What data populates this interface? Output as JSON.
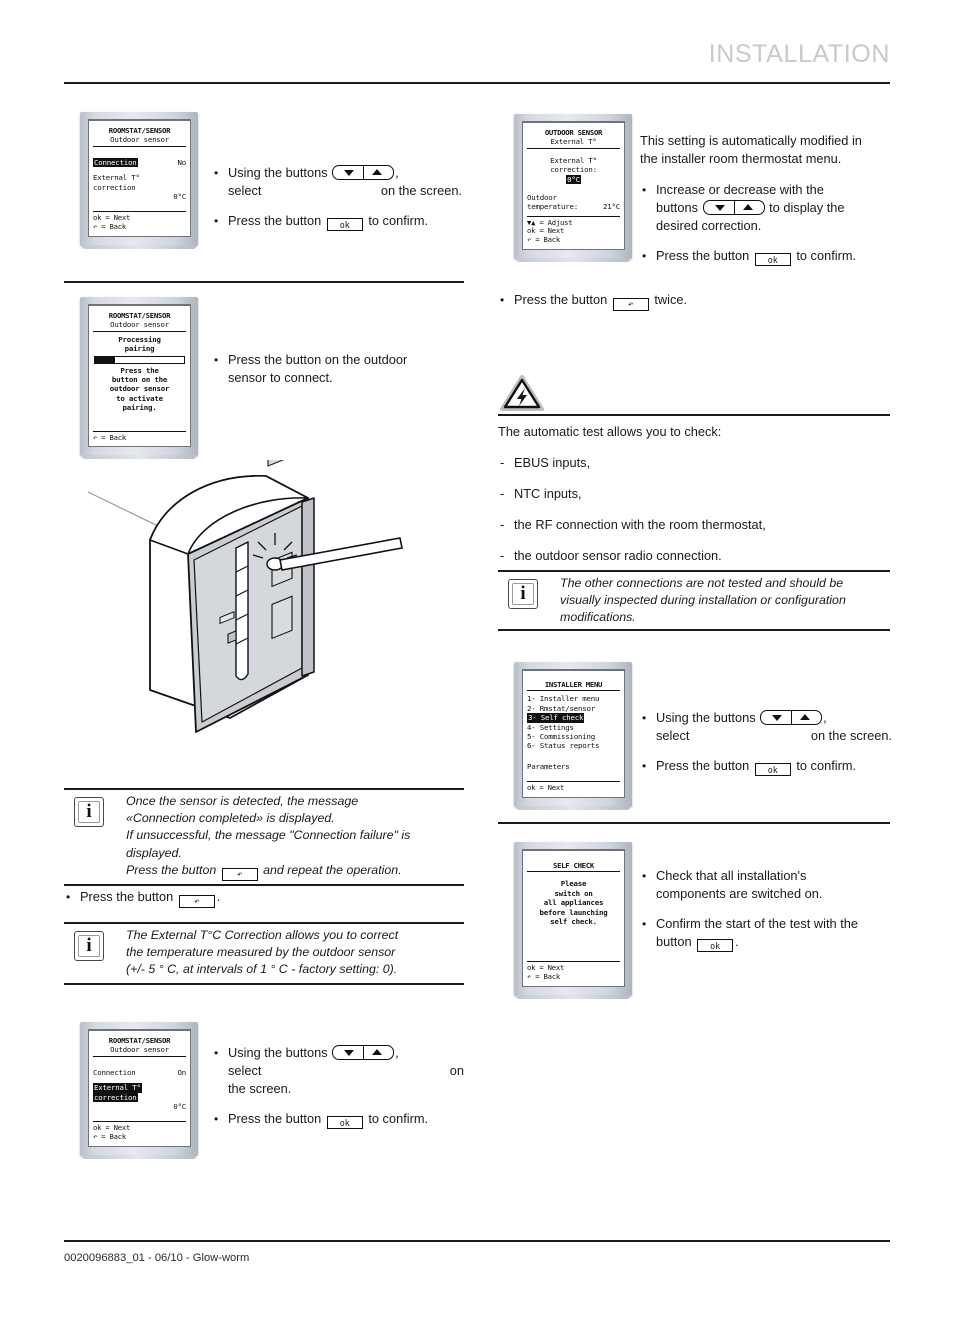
{
  "header": {
    "title": "INSTALLATION"
  },
  "footer": {
    "text": "0020096883_01 - 06/10 - Glow-worm"
  },
  "keys": {
    "ok": "ok",
    "back": "↶",
    "arrows_label": "down-up-arrows"
  },
  "left_column": {
    "step1": {
      "screen": {
        "title": "ROOMSTAT/SENSOR",
        "subtitle": "Outdoor sensor",
        "row1_label": "Connection",
        "row1_value": "No",
        "row2_label_line1": "External T°",
        "row2_label_line2": "correction",
        "row2_value": "0°C",
        "foot_line1": "ok  = Next",
        "foot_line2": "↶   = Back"
      },
      "bullet1_pre": "Using the buttons",
      "bullet1_post": ",",
      "bullet1_line2_pre": "select",
      "bullet1_line2_post": "on the screen.",
      "bullet2_pre": "Press the button",
      "bullet2_post": "to confirm."
    },
    "step2": {
      "screen": {
        "title": "ROOMSTAT/SENSOR",
        "subtitle": "Outdoor sensor",
        "msg_line1": "Processing",
        "msg_line2": "pairing",
        "body_line1": "Press the",
        "body_line2": "button on the",
        "body_line3": "outdoor sensor",
        "body_line4": "to activate",
        "body_line5": "pairing.",
        "foot_line1": "↶   = Back"
      },
      "bullet1_line1": "Press the button on the outdoor",
      "bullet1_line2": "sensor to connect."
    },
    "note1": {
      "line1": "Once the sensor is detected, the message",
      "line2": "«Connection completed» is displayed.",
      "line3": "If unsuccessful, the message \"Connection failure\" is",
      "line4": "displayed.",
      "line5_pre": "Press the button",
      "line5_post": "and repeat the operation."
    },
    "press_back_bullet": {
      "pre": "Press the button",
      "post": "."
    },
    "note2": {
      "line1": "The External T°C Correction allows you to correct",
      "line2": "the temperature measured by the outdoor sensor",
      "line3": "(+/- 5 ° C, at intervals of  1 ° C - factory setting: 0)."
    },
    "step3": {
      "screen": {
        "title": "ROOMSTAT/SENSOR",
        "subtitle": "Outdoor sensor",
        "row1_label": "Connection",
        "row1_value": "On",
        "row2_label_line1": "External T°",
        "row2_label_line2": "correction",
        "row2_value": "0°C",
        "foot_line1": "ok  = Next",
        "foot_line2": "↶   = Back"
      },
      "bullet1_pre": "Using the buttons",
      "bullet1_post": ",",
      "bullet1_line2_pre": "select",
      "bullet1_line2_post": "on",
      "bullet1_line3": "the screen.",
      "bullet2_pre": "Press the button",
      "bullet2_post": "to confirm."
    }
  },
  "right_column": {
    "step1": {
      "screen": {
        "title": "OUTDOOR SENSOR",
        "subtitle": "External T°",
        "body_line1": "External T°",
        "body_line2": "correction:",
        "body_value": "0°C",
        "row_label_line1": "Outdoor",
        "row_label_line2": "temperature:",
        "row_value": "21°C",
        "foot_line1": "▼▲ = Adjust",
        "foot_line2": "ok  = Next",
        "foot_line3": "↶   = Back"
      },
      "para_line1": "This setting is automatically modified in",
      "para_line2": "the installer room thermostat menu.",
      "bullet1_line1": "Increase or decrease with the",
      "bullet1_line2_pre": "buttons",
      "bullet1_line2_post": "to display the",
      "bullet1_line3": "desired correction.",
      "bullet2_pre": "Press the button",
      "bullet2_post": "to confirm."
    },
    "press_back_twice": {
      "pre": "Press the button",
      "post": "twice."
    },
    "warning_icon": "electrical-hazard-triangle-icon",
    "test_intro": "The automatic test allows you to check:",
    "test_items": [
      "EBUS inputs,",
      "NTC inputs,",
      "the RF connection with the room thermostat,",
      "the outdoor sensor radio connection."
    ],
    "note1": {
      "line1": "The other connections are not tested and should be",
      "line2": "visually inspected during installation or configuration",
      "line3": "modifications."
    },
    "step2": {
      "screen": {
        "title": "INSTALLER MENU",
        "items": [
          "1- Installer menu",
          "2- Rmstat/sensor",
          "3- Self check",
          "4- Settings",
          "5- Commissioning",
          "6- Status reports"
        ],
        "selected_index": 2,
        "parameters_label": "Parameters",
        "foot_line1": "ok  = Next"
      },
      "bullet1_pre": "Using the buttons",
      "bullet1_post": ",",
      "bullet1_line2_pre": "select",
      "bullet1_line2_post": "on the screen.",
      "bullet2_pre": "Press the button",
      "bullet2_post": "to confirm."
    },
    "step3": {
      "screen": {
        "title": "SELF CHECK",
        "body_line1": "Please",
        "body_line2": "switch on",
        "body_line3": "all appliances",
        "body_line4": "before launching",
        "body_line5": "self check.",
        "foot_line1": "ok  = Next",
        "foot_line2": "↶   = Back"
      },
      "bullet1_line1": "Check that all installation's",
      "bullet1_line2": "components are switched on.",
      "bullet2_line1": "Confirm the start of the test with the",
      "bullet2_pre": "button",
      "bullet2_post": "."
    }
  },
  "illustration": {
    "name": "outdoor-sensor-housing-with-tool-illustration"
  },
  "colors": {
    "header_title": "#c9c9cb",
    "rule": "#1a1a1a",
    "lcd_bezel": "#d4d9e0",
    "text": "#1a1a1a"
  }
}
